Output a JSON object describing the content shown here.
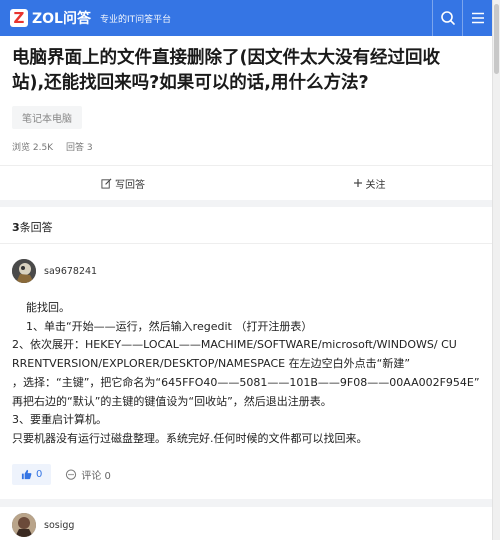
{
  "header": {
    "logo_letter": "Z",
    "logo_text": "ZOL问答",
    "slogan": "专业的IT问答平台",
    "bg_color": "#3575e4",
    "icons": [
      "search-icon",
      "menu-icon"
    ]
  },
  "question": {
    "title_line1": "电脑界面上的文件直接删除了(因文件太大没有经过回收",
    "title_line2": "站),还能找回来吗?如果可以的话,用什么方法?",
    "tag": "笔记本电脑",
    "views_label": "浏览 2.5K",
    "answers_label": "回答 3"
  },
  "actions": {
    "write_answer": "写回答",
    "follow": "关注"
  },
  "answers_section": {
    "count_num": "3",
    "count_suffix": "条回答",
    "answers": [
      {
        "author": "sa9678241",
        "lines": [
          "    能找回。",
          "    1、单击“开始——运行，然后输入regedit （打开注册表）",
          "2、依次展开：HEKEY——LOCAL——MACHIME/SOFTWARE/microsoft/WINDOWS/ CU",
          "RRENTVERSION/EXPLORER/DESKTOP/NAMESPACE 在左边空白外点击“新建”",
          "，选择：“主键”，把它命名为“645FFO40——5081——101B——9F08——00AA002F954E”",
          "再把右边的“默认”的主键的键值设为“回收站”，然后退出注册表。",
          "3、要重启计算机。",
          "只要机器没有运行过磁盘整理。系统完好.任何时候的文件都可以找回来。"
        ],
        "likes": "0",
        "comment_label": "评论 0"
      },
      {
        "author": "sosigg"
      }
    ]
  }
}
